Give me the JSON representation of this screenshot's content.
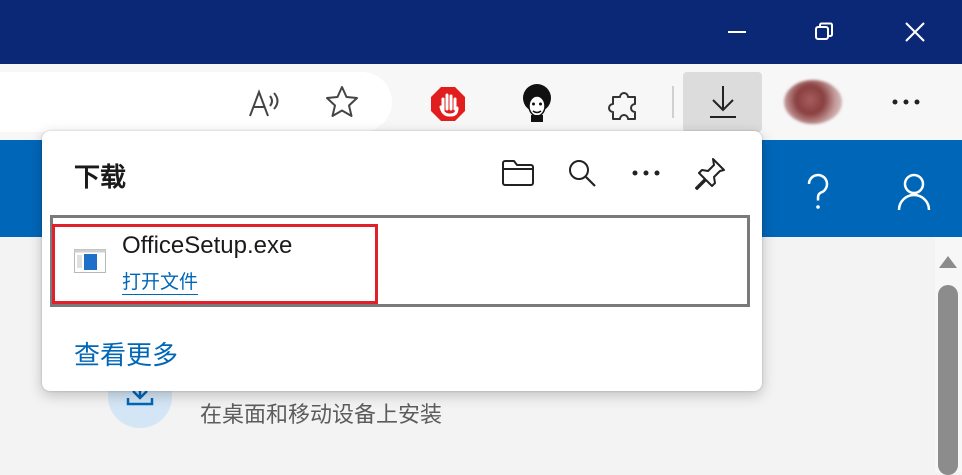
{
  "window_controls": {
    "minimize_icon": "minimize-icon",
    "restore_icon": "restore-icon",
    "close_icon": "close-icon"
  },
  "toolbar": {
    "read_aloud_icon": "read-aloud-icon",
    "favorite_icon": "star-icon",
    "extension_adblock_icon": "stop-hand-icon",
    "extension_avatar_icon": "afro-face-icon",
    "extensions_icon": "puzzle-icon",
    "downloads_icon": "download-arrow-icon",
    "profile_icon": "profile-avatar",
    "more_icon": "ellipsis-icon"
  },
  "site_header": {
    "help_icon": "question-icon",
    "account_icon": "person-icon"
  },
  "downloads": {
    "title": "下载",
    "folder_icon": "folder-icon",
    "search_icon": "search-icon",
    "more_icon": "ellipsis-icon",
    "pin_icon": "pin-icon",
    "items": [
      {
        "file_name": "OfficeSetup.exe",
        "action": "打开文件"
      }
    ],
    "see_more": "查看更多"
  },
  "page": {
    "install_text": "在桌面和移动设备上安装"
  },
  "colors": {
    "titlebar": "#0a2875",
    "site_header": "#0067b8",
    "link": "#0067b8",
    "highlight": "#e0212c"
  }
}
